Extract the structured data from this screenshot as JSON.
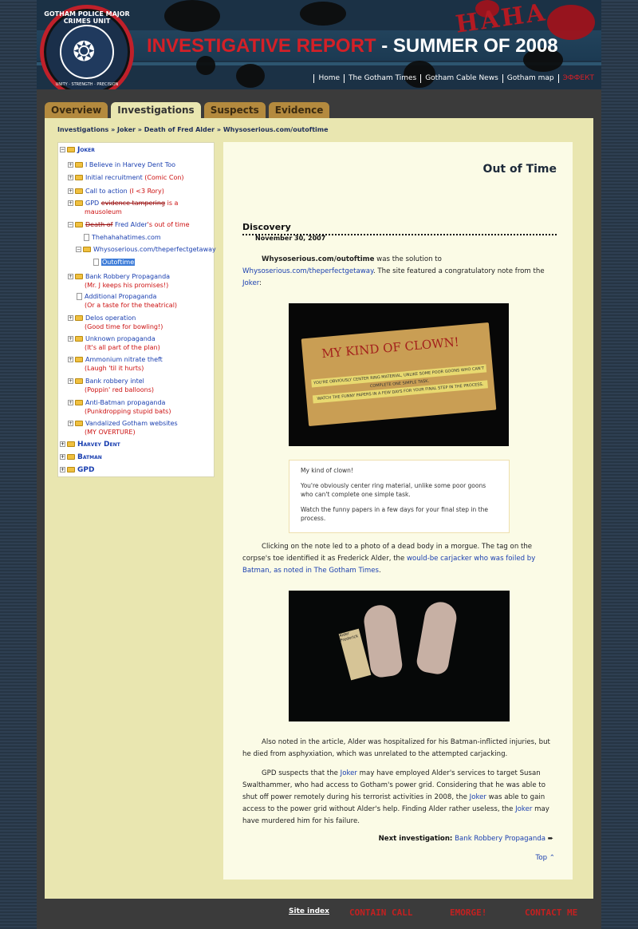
{
  "header": {
    "title_part1": "INVESTIGATIVE REPORT",
    "title_part2": " - SUMMER OF 2008",
    "seal_top": "GOTHAM POLICE MAJOR CRIMES UNIT",
    "seal_bottom": "UNITY · STRENGTH · PRECISION",
    "haha": "HAHA",
    "nav": [
      "Home",
      "The Gotham Times",
      "Gotham Cable News",
      "Gotham map"
    ],
    "nav_red": "ЭФФЕКТ"
  },
  "tabs": [
    "Overview",
    "Investigations",
    "Suspects",
    "Evidence"
  ],
  "breadcrumb": "Investigations » Joker » Death of Fred Alder » Whysoserious.com/outoftime",
  "tree": {
    "joker": "Joker",
    "items": [
      {
        "t": "I Believe in Harvey Dent Too",
        "s": ""
      },
      {
        "t": "Initial recruitment",
        "s": " (Comic Con)"
      },
      {
        "t": "Call to action",
        "s": " (I <3 Rory)"
      },
      {
        "t": "GPD",
        "strike": "evidence tampering",
        "s": " is a"
      },
      {
        "s2": "mausoleum"
      },
      {
        "strike": "Death of",
        "t": " Fred Alder",
        "s": "'s out of time"
      }
    ],
    "sub1": "Thehahahatimes.com",
    "sub2": "Whysoserious.com/theperfectgetaway",
    "sub3": "Outoftime",
    "lower": [
      {
        "t": "Bank Robbery Propaganda",
        "s": "(Mr. J keeps his promises!)"
      },
      {
        "t": "Additional Propaganda",
        "s": "(Or a taste for the theatrical)"
      },
      {
        "t": "Delos operation",
        "s": "(Good time for bowling!)"
      },
      {
        "t": "Unknown propaganda",
        "s": "(It's all part of the plan)"
      },
      {
        "t": "Ammonium nitrate theft",
        "s": "(Laugh 'til it hurts)"
      },
      {
        "t": "Bank robbery intel",
        "s": "(Poppin' red balloons)"
      },
      {
        "t": "Anti-Batman propaganda",
        "s": "(Punkdropping stupid bats)"
      },
      {
        "t": "Vandalized Gotham websites",
        "s": "(MY OVERTURE)"
      }
    ],
    "top": [
      "Harvey Dent",
      "Batman",
      "GPD"
    ]
  },
  "main": {
    "title": "Out of Time",
    "section": "Discovery",
    "date": "November 30, 2007",
    "p1_bold": "Whysoserious.com/outoftime",
    "p1_a": " was the solution to ",
    "p1_link": "Whysoserious.com/theperfectgetaway",
    "p1_b": ". The site featured a congratulatory note from the ",
    "p1_link2": "Joker",
    "p1_c": ":",
    "img1_title": "MY KIND OF CLOWN!",
    "img1_line1": "YOU'RE OBVIOUSLY CENTER RING MATERIAL, UNLIKE SOME POOR GOONS WHO CAN'T COMPLETE ONE SIMPLE TASK.",
    "img1_line2": "WATCH THE FUNNY PAPERS IN A FEW DAYS FOR YOUR FINAL STEP IN THE PROCESS.",
    "quote": [
      "My kind of clown!",
      "You're obviously center ring material, unlike some poor goons who can't complete one simple task.",
      "Watch the funny papers in a few days for your final step in the process."
    ],
    "p2_a": "Clicking on the note led to a photo of a dead body in a morgue. The tag on the corpse's toe identified it as Frederick Alder, the ",
    "p2_link": "would-be carjacker who was foiled by Batman, as noted in The Gotham Times",
    "p2_b": ".",
    "tag_text": "Alder Frederick",
    "p3": "Also noted in the article, Alder was hospitalized for his Batman-inflicted injuries, but he died from asphyxiation, which was unrelated to the attempted carjacking.",
    "p4_a": "GPD suspects that the ",
    "p4_joker": "Joker",
    "p4_b": " may have employed Alder's services to target Susan Swalthammer, who had access to Gotham's power grid. Considering that he was able to shut off power remotely during his terrorist activities in 2008, the ",
    "p4_c": " was able to gain access to the power grid without Alder's help. Finding Alder rather useless, the ",
    "p4_d": " may have murdered him for his failure.",
    "next_label": "Next investigation:",
    "next_link": "Bank Robbery Propaganda",
    "top_link": "Top"
  },
  "footer": {
    "site_index": "Site index",
    "links": [
      "CONTAIN CALL",
      "EMORGE!",
      "CONTACT ME"
    ]
  }
}
